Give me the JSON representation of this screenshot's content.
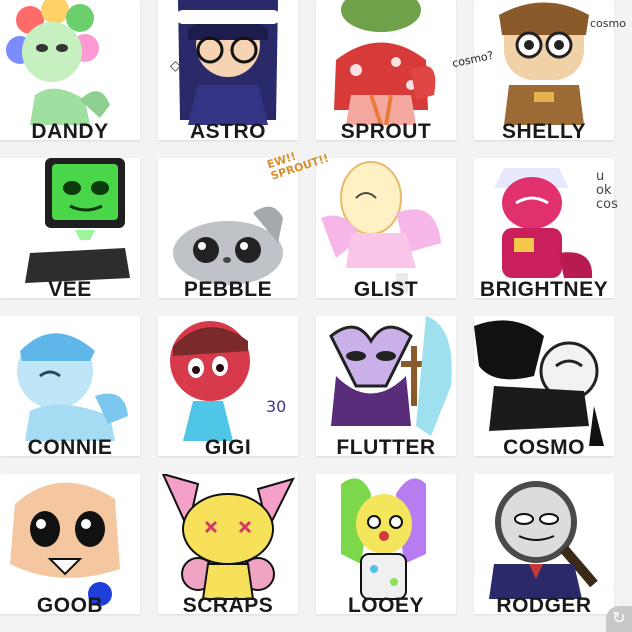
{
  "characters": [
    {
      "name": "DANDY"
    },
    {
      "name": "ASTRO"
    },
    {
      "name": "SPROUT"
    },
    {
      "name": "SHELLY"
    },
    {
      "name": "VEE"
    },
    {
      "name": "PEBBLE"
    },
    {
      "name": "GLIST"
    },
    {
      "name": "BRIGHTNEY"
    },
    {
      "name": "CONNIE"
    },
    {
      "name": "GIGI"
    },
    {
      "name": "FLUTTER"
    },
    {
      "name": "COSMO"
    },
    {
      "name": "GOOB"
    },
    {
      "name": "SCRAPS"
    },
    {
      "name": "LOOEY"
    },
    {
      "name": "RODGER"
    }
  ],
  "annotations": {
    "shelly_note": "cosmo?",
    "glisten_note": "EW!!\nSPROUT!!",
    "gigi_number": "30",
    "brightney_note": "u\nok\ncos",
    "cosmo_side_note": "cosmo"
  },
  "corner_button_icon": "rotate-icon"
}
